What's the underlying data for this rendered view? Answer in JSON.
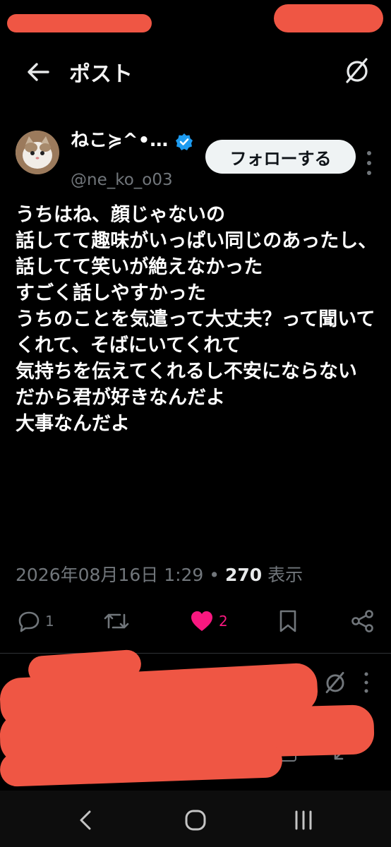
{
  "header": {
    "title": "ポスト",
    "back_icon": "arrow-left-icon",
    "grok_icon": "grok-icon"
  },
  "author": {
    "name": "ねこ≽^•…",
    "handle": "@ne_ko_o03",
    "verified": true,
    "follow_label": "フォローする"
  },
  "tweet": {
    "text": "うちはね、顔じゃないの\n話してて趣味がいっぱい同じのあったし、話してて笑いが絶えなかった\nすごく話しやすかった\nうちのことを気遣って大丈夫？って聞いてくれて、そばにいてくれて\n気持ちを伝えてくれるし不安にならない\nだから君が好きなんだよ\n大事なんだよ",
    "date": "2026年08月16日 1:29",
    "separator": "•",
    "views": "270",
    "views_label": "表示"
  },
  "actions": {
    "reply_count": "1",
    "retweet_count": "",
    "like_count": "2"
  },
  "colors": {
    "like": "#f91880",
    "verified": "#1d9bf0",
    "redaction": "#ef5644"
  }
}
